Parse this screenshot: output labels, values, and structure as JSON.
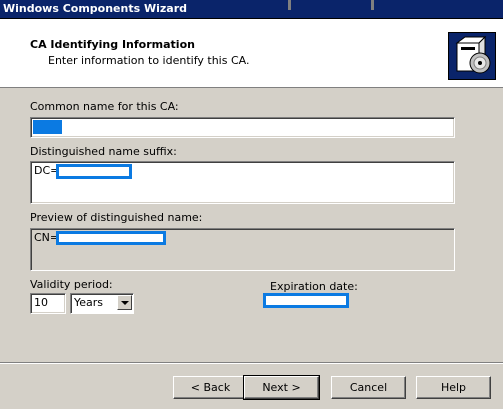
{
  "window": {
    "title": "Windows Components Wizard"
  },
  "header": {
    "heading": "CA Identifying Information",
    "subheading": "Enter information to identify this CA.",
    "logo_icon": "wizard-cd-box-icon"
  },
  "form": {
    "common_name": {
      "label": "Common name for this CA:",
      "value": ""
    },
    "dn_suffix": {
      "label": "Distinguished name suffix:",
      "value": "DC="
    },
    "dn_preview": {
      "label": "Preview of distinguished name:",
      "value": "CN="
    },
    "validity": {
      "label": "Validity period:",
      "value": "10",
      "unit": "Years"
    },
    "expiration": {
      "label": "Expiration date:",
      "value": ""
    }
  },
  "buttons": {
    "back": "< Back",
    "next": "Next >",
    "cancel": "Cancel",
    "help": "Help"
  },
  "colors": {
    "titlebar": "#0a246a",
    "redaction": "#0b7ae2",
    "face": "#d4d0c8"
  }
}
